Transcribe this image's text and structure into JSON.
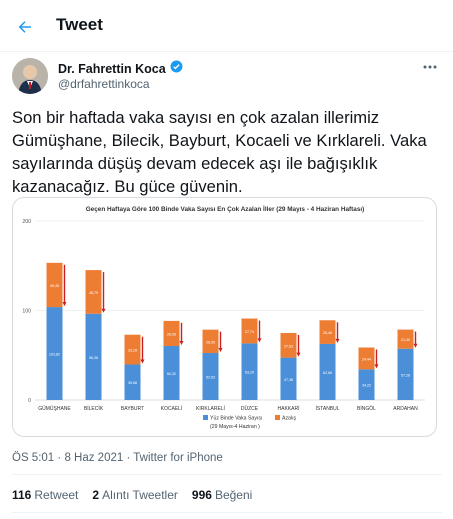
{
  "header": {
    "title": "Tweet"
  },
  "author": {
    "display_name": "Dr. Fahrettin Koca",
    "handle": "@drfahrettinkoca"
  },
  "tweet": {
    "text": "Son bir haftada vaka sayısı en çok azalan illerimiz Gümüşhane, Bilecik, Bayburt, Kocaeli ve Kırklareli. Vaka sayılarında düşüş devam edecek aşı ile bağışıklık kazanacağız. Bu güce güvenin."
  },
  "meta": {
    "time": "ÖS 5:01",
    "date": "8 Haz 2021",
    "source": "Twitter for iPhone"
  },
  "stats": {
    "retweets_count": "116",
    "retweets_label": "Retweet",
    "quotes_count": "2",
    "quotes_label": "Alıntı Tweetler",
    "likes_count": "996",
    "likes_label": "Beğeni"
  },
  "colors": {
    "accent": "#1d9bf0",
    "bar_blue": "#4a8fd8",
    "bar_orange": "#ee7d34",
    "arrow_red": "#cc1f1f"
  },
  "chart_data": {
    "type": "bar",
    "stacked": true,
    "title": "Geçen Haftaya Göre 100 Binde Vaka Sayısı En Çok Azalan İller (29 Mayıs - 4 Haziran Haftası)",
    "categories": [
      "GÜMÜŞHANE",
      "BİLECİK",
      "BAYBURT",
      "KOCAELİ",
      "KIRKLARELİ",
      "DÜZCE",
      "HAKKARİ",
      "İSTANBUL",
      "BİNGÖL",
      "ARDAHAN"
    ],
    "series": [
      {
        "name": "Yüz Binde Vaka Sayısı",
        "values": [
          103.82,
          96.36,
          39.68,
          60.32,
          52.53,
          63.29,
          47.38,
          62.65,
          34.22,
          57.28
        ]
      },
      {
        "name": "Azalış",
        "values": [
          49.45,
          48.79,
          33.28,
          28.06,
          26.06,
          27.74,
          27.53,
          26.46,
          24.44,
          21.4
        ]
      }
    ],
    "legend_note": "(29 Mayıs-4 Haziran )",
    "ylim": [
      0,
      200
    ],
    "yticks": [
      0,
      100,
      200
    ],
    "legend_position": "bottom"
  }
}
